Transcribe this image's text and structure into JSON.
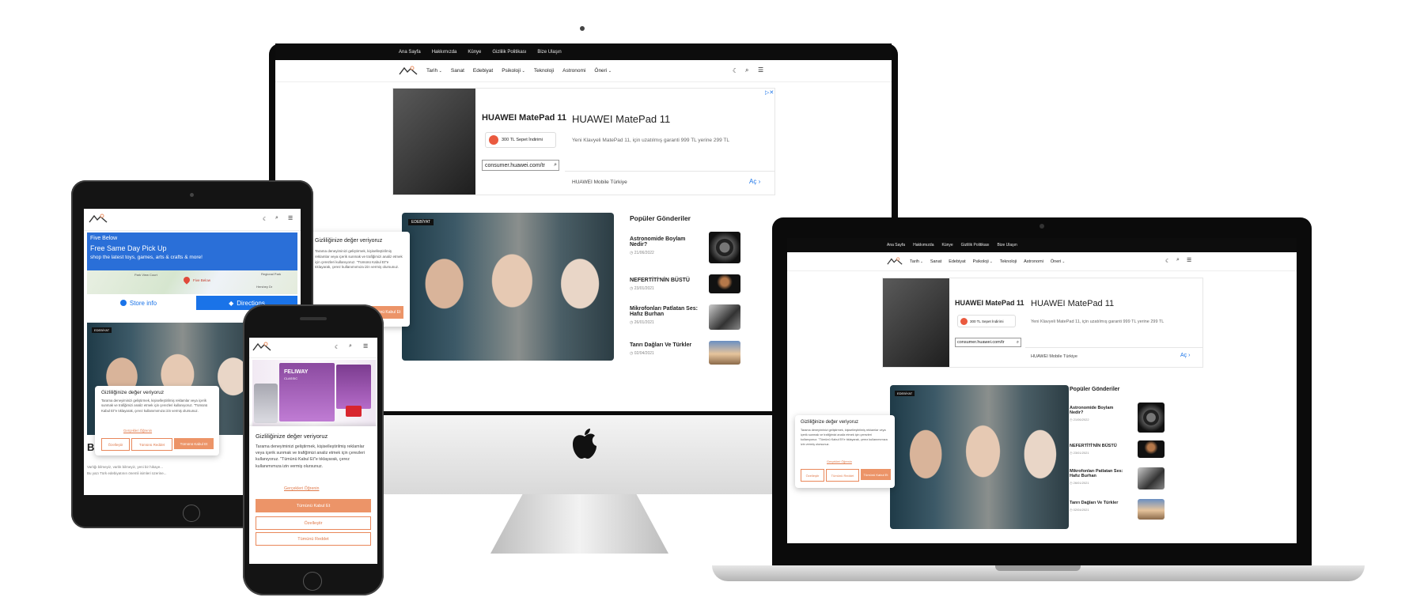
{
  "site": {
    "topbar_links": [
      "Ana Sayfa",
      "Hakkımızda",
      "Künye",
      "Gizlilik Politikası",
      "Bize Ulaşın"
    ],
    "nav_items": [
      "Tarih",
      "Sanat",
      "Edebiyat",
      "Psikoloji",
      "Teknoloji",
      "Astronomi",
      "Öneri"
    ],
    "nav_dropdown_flags": [
      true,
      false,
      false,
      true,
      false,
      false,
      true
    ],
    "accent": "#ec9468",
    "icons": [
      "moon-icon",
      "search-icon",
      "menu-icon"
    ]
  },
  "ad_huawei": {
    "brand": "HUAWEI MatePad 11",
    "headline": "HUAWEI MatePad 11",
    "description": "Yeni Klavyeli MatePad 11, için uzatılmış garanti 999 TL yerine 299 TL",
    "badge": "300 TL Sepet İndirimi",
    "url": "consumer.huawei.com/tr",
    "advertiser": "HUAWEI Mobile Türkiye",
    "cta": "Aç"
  },
  "ad_fivebelow": {
    "brand": "Five Below",
    "headline": "Free Same Day Pick Up",
    "description": "shop the latest toys, games, arts & crafts & more!",
    "store_info": "Store info",
    "directions": "Directions",
    "map_labels": [
      "Park View Court",
      "Regional Park",
      "Five Below",
      "Hershey Dr"
    ]
  },
  "ad_feliway": {
    "brand": "FELIWAY",
    "subtitle": "CLASSIC"
  },
  "featured": {
    "tag": "EDEBİYAT",
    "title_fragment": "Bi"
  },
  "popular": {
    "heading": "Popüler Gönderiler",
    "posts": [
      {
        "title": "Astronomide Boylam Nedir?",
        "date": "21/06/2022"
      },
      {
        "title": "NEFERTİTİ'NİN BÜSTÜ",
        "date": "23/01/2021"
      },
      {
        "title": "Mikrofonları Patlatan Ses: Hafız Burhan",
        "date": "26/01/2021"
      },
      {
        "title": "Tanrı Dağları Ve Türkler",
        "date": "02/04/2021"
      }
    ]
  },
  "consent": {
    "title": "Gizliliğinize değer veriyoruz",
    "body": "Tarama deneyiminizi geliştirmek, kişiselleştirilmiş reklamlar veya içerik sunmak ve trafiğimizi analiz etmek için çerezleri kullanıyoruz. \"Tümünü Kabul Et\"e tıklayarak, çerez kullanımımıza izin vermiş olursunuz.",
    "policy_link": "Gerçekleri Öğrenin",
    "customize": "Özelleştir",
    "reject_all": "Tümünü Reddet",
    "accept_all": "Tümünü Kabul Et"
  },
  "teaser": {
    "line1": "Varlığı bilmeyiz, varlık bilmeyiz, yeni bir hikaye...",
    "line2": "Bu yazı Türk edebiyatının önemli isimleri üzerine..."
  }
}
